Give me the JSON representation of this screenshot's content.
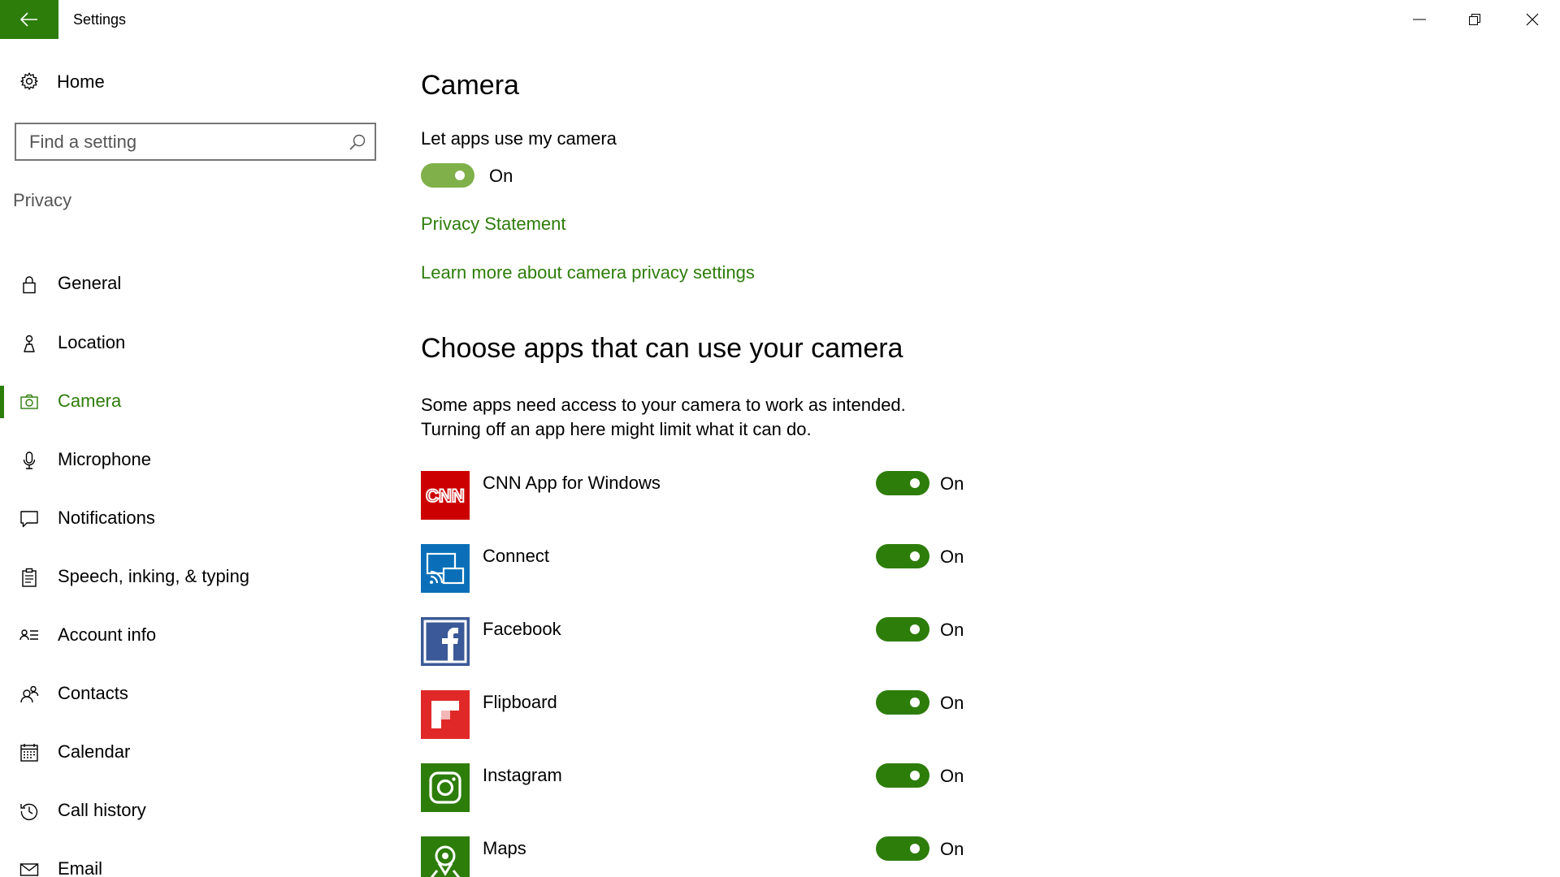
{
  "window": {
    "title": "Settings"
  },
  "sidebar": {
    "home_label": "Home",
    "search_placeholder": "Find a setting",
    "group_label": "Privacy",
    "items": [
      {
        "label": "General",
        "icon": "lock-icon"
      },
      {
        "label": "Location",
        "icon": "location-icon"
      },
      {
        "label": "Camera",
        "icon": "camera-icon",
        "active": true
      },
      {
        "label": "Microphone",
        "icon": "microphone-icon"
      },
      {
        "label": "Notifications",
        "icon": "notifications-icon"
      },
      {
        "label": "Speech, inking, & typing",
        "icon": "clipboard-icon"
      },
      {
        "label": "Account info",
        "icon": "account-info-icon"
      },
      {
        "label": "Contacts",
        "icon": "contacts-icon"
      },
      {
        "label": "Calendar",
        "icon": "calendar-icon"
      },
      {
        "label": "Call history",
        "icon": "history-icon"
      },
      {
        "label": "Email",
        "icon": "email-icon"
      }
    ]
  },
  "main": {
    "title": "Camera",
    "master_label": "Let apps use my camera",
    "master_state": "On",
    "privacy_link": "Privacy Statement",
    "learn_link": "Learn more about camera privacy settings",
    "section_title": "Choose apps that can use your camera",
    "description_line1": "Some apps need access to your camera to work as intended.",
    "description_line2": "Turning off an app here might limit what it can do.",
    "apps": [
      {
        "name": "CNN App for Windows",
        "state": "On",
        "icon": "cnn-logo",
        "color": "#cc0000"
      },
      {
        "name": "Connect",
        "state": "On",
        "icon": "connect-logo",
        "color": "#0a6fb8"
      },
      {
        "name": "Facebook",
        "state": "On",
        "icon": "facebook-logo",
        "color": "#3b5998"
      },
      {
        "name": "Flipboard",
        "state": "On",
        "icon": "flipboard-logo",
        "color": "#e12828"
      },
      {
        "name": "Instagram",
        "state": "On",
        "icon": "instagram-logo",
        "color": "#2d7d0a"
      },
      {
        "name": "Maps",
        "state": "On",
        "icon": "maps-logo",
        "color": "#2d7d0a"
      }
    ]
  },
  "colors": {
    "accent": "#2d7d0a",
    "master_toggle": "#7fb049"
  }
}
